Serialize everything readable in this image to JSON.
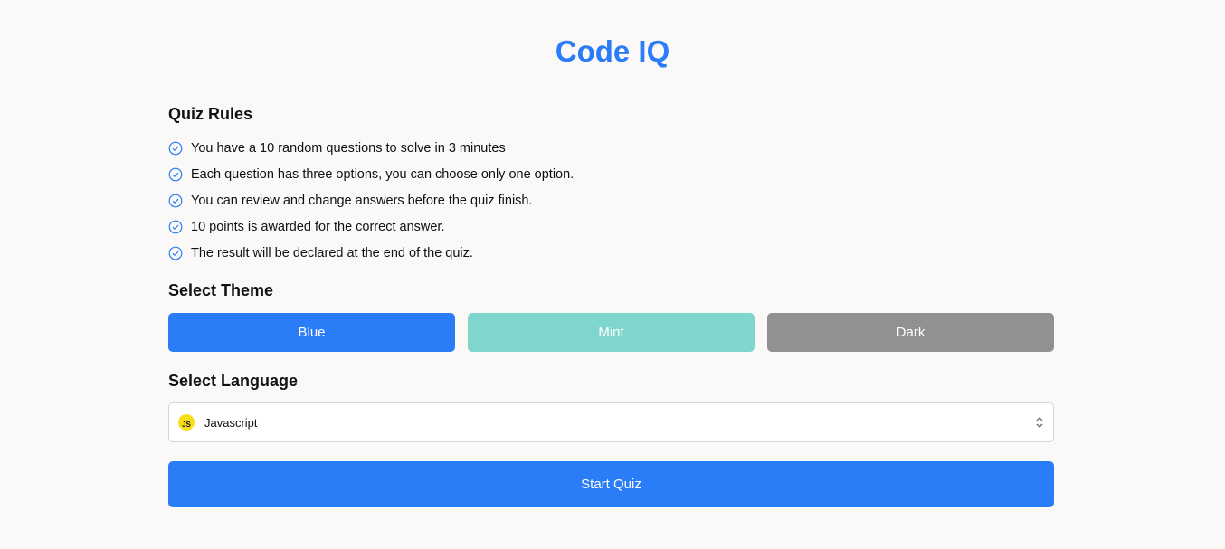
{
  "app": {
    "title": "Code IQ"
  },
  "rules": {
    "heading": "Quiz Rules",
    "items": [
      "You have a 10 random questions to solve in 3 minutes",
      "Each question has three options, you can choose only one option.",
      "You can review and change answers before the quiz finish.",
      "10 points is awarded for the correct answer.",
      "The result will be declared at the end of the quiz."
    ],
    "icon": "check-circle-icon"
  },
  "theme": {
    "heading": "Select Theme",
    "options": [
      {
        "label": "Blue",
        "color": "#2a7cf7"
      },
      {
        "label": "Mint",
        "color": "#7fd6cd"
      },
      {
        "label": "Dark",
        "color": "#919191"
      }
    ]
  },
  "language": {
    "heading": "Select Language",
    "selected": "Javascript",
    "badge": "JS"
  },
  "start": {
    "label": "Start Quiz"
  }
}
